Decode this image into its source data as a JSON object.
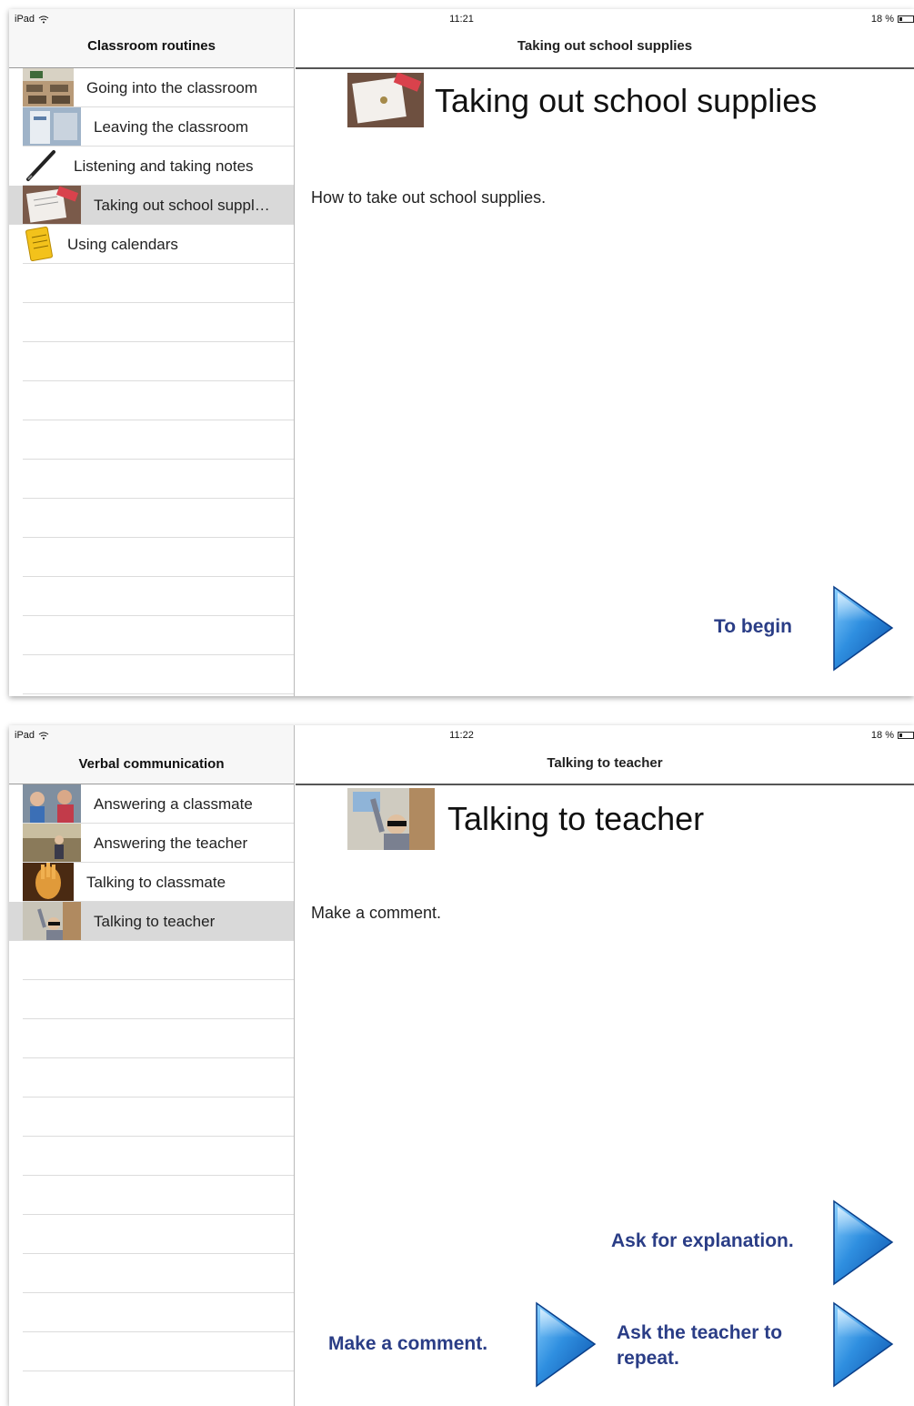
{
  "screens": [
    {
      "status": {
        "device": "iPad",
        "time": "11:21",
        "battery": "18 %"
      },
      "sidebar": {
        "title": "Classroom routines",
        "items": [
          {
            "label": "Going into the classroom",
            "selected": false
          },
          {
            "label": "Leaving the classroom",
            "selected": false
          },
          {
            "label": "Listening and taking notes",
            "selected": false
          },
          {
            "label": "Taking out school suppl…",
            "selected": true
          },
          {
            "label": "Using calendars",
            "selected": false
          }
        ]
      },
      "main": {
        "header": "Taking out school supplies",
        "title": "Taking out school supplies",
        "description": "How to take out school supplies.",
        "actions": [
          {
            "label": "To begin"
          }
        ]
      }
    },
    {
      "status": {
        "device": "iPad",
        "time": "11:22",
        "battery": "18 %"
      },
      "sidebar": {
        "title": "Verbal communication",
        "items": [
          {
            "label": "Answering a classmate",
            "selected": false
          },
          {
            "label": "Answering the teacher",
            "selected": false
          },
          {
            "label": "Talking to classmate",
            "selected": false
          },
          {
            "label": "Talking to teacher",
            "selected": true
          }
        ]
      },
      "main": {
        "header": "Talking to teacher",
        "title": "Talking to teacher",
        "description": "Make a comment.",
        "actions": [
          {
            "label": "Ask for explanation."
          },
          {
            "label": "Make a comment."
          },
          {
            "label": "Ask the teacher to repeat."
          }
        ]
      }
    }
  ],
  "colors": {
    "accent_text": "#2a3d86",
    "arrow_blue": "#2f8fe0",
    "selected_row": "#d9d9d9"
  }
}
